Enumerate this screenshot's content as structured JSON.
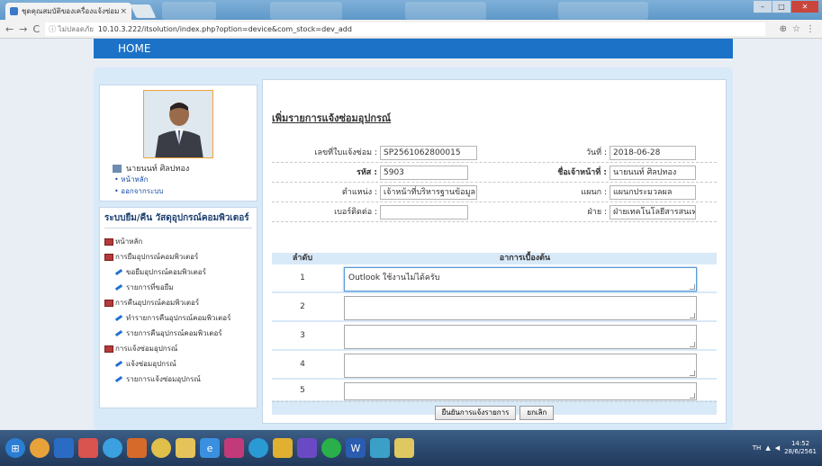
{
  "browser": {
    "tab_title": "ชุดคุณสมบัติของเครื่องแจ้งซ่อม",
    "tab_close": "×",
    "url_security": "ไม่ปลอดภัย",
    "url": "10.10.3.222/itsolution/index.php?option=device&com_stock=dev_add",
    "minimize": "–",
    "maximize": "□",
    "close": "✕"
  },
  "header": {
    "home_label": "HOME"
  },
  "profile": {
    "user_name": "นายนนท์ ศิลปทอง",
    "links": [
      "• หน้าหลัก",
      "• ออกจากระบบ"
    ]
  },
  "menu": {
    "title": "ระบบยืม/คืน วัสดุอุปกรณ์คอมพิวเตอร์",
    "items": [
      {
        "label": "หน้าหลัก",
        "level": 0
      },
      {
        "label": "การยืมอุปกรณ์คอมพิวเตอร์",
        "level": 0
      },
      {
        "label": "ขอยืมอุปกรณ์คอมพิวเตอร์",
        "level": 1
      },
      {
        "label": "รายการที่ขอยืม",
        "level": 1
      },
      {
        "label": "การคืนอุปกรณ์คอมพิวเตอร์",
        "level": 0
      },
      {
        "label": "ทำรายการคืนอุปกรณ์คอมพิวเตอร์",
        "level": 1
      },
      {
        "label": "รายการคืนอุปกรณ์คอมพิวเตอร์",
        "level": 1
      },
      {
        "label": "การแจ้งซ่อมอุปกรณ์",
        "level": 0
      },
      {
        "label": "แจ้งซ่อมอุปกรณ์",
        "level": 1
      },
      {
        "label": "รายการแจ้งซ่อมอุปกรณ์",
        "level": 1
      }
    ]
  },
  "form": {
    "title": "เพิ่มรายการแจ้งซ่อมอุปกรณ์",
    "repair_no_label": "เลขที่ใบแจ้งซ่อม :",
    "repair_no": "SP2561062800015",
    "date_label": "วันที่ :",
    "date": "2018-06-28",
    "code_label": "รหัส :",
    "code": "5903",
    "staff_label": "ชื่อเจ้าหน้าที่ :",
    "staff": "นายนนท์ ศิลปทอง",
    "position_label": "ตำแหน่ง :",
    "position": "เจ้าหน้าที่บริหารฐานข้อมูล",
    "dept_label": "แผนก :",
    "dept": "แผนกประมวลผล",
    "phone_label": "เบอร์ติดต่อ :",
    "phone": "",
    "division_label": "ฝ่าย :",
    "division": "ฝ่ายเทคโนโลยีสารสนเทศ"
  },
  "table": {
    "col_no": "ลำดับ",
    "col_symptom": "อาการเบื้องต้น",
    "rows": [
      {
        "no": "1",
        "symptom": "Outlook ใช้งานไม่ได้ครับ"
      },
      {
        "no": "2",
        "symptom": ""
      },
      {
        "no": "3",
        "symptom": ""
      },
      {
        "no": "4",
        "symptom": ""
      },
      {
        "no": "5",
        "symptom": ""
      }
    ]
  },
  "buttons": {
    "confirm": "ยืนยันการแจ้งรายการ",
    "cancel": "ยกเลิก"
  },
  "taskbar": {
    "lang": "TH",
    "time": "14:52",
    "date": "28/6/2561"
  }
}
